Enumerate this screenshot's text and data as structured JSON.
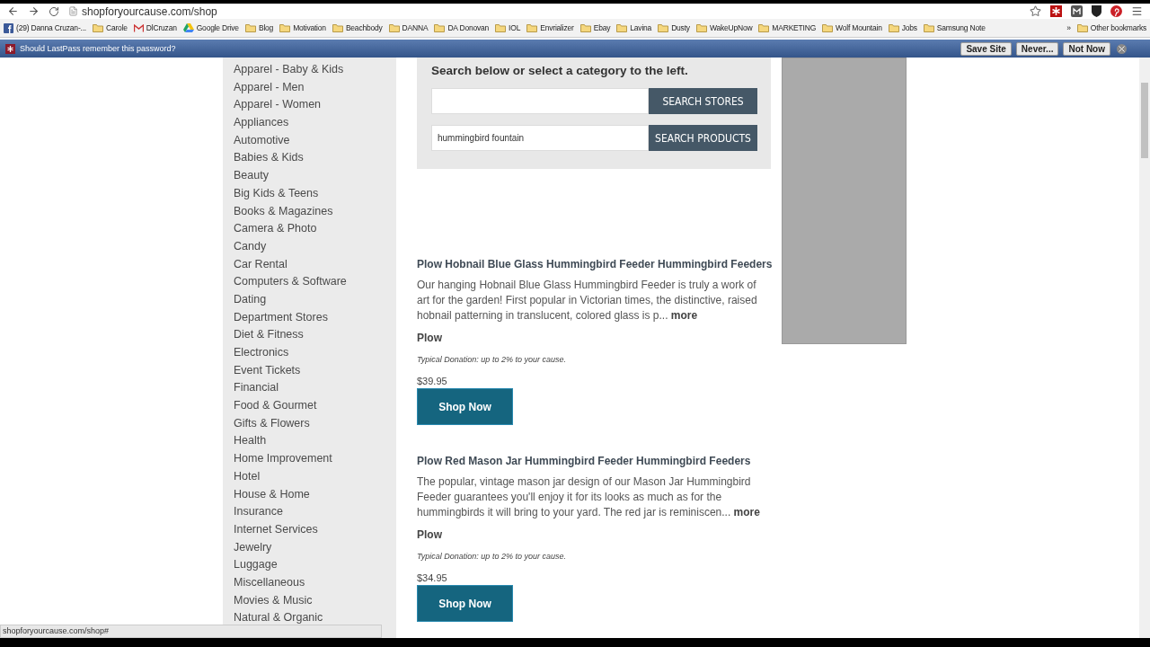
{
  "browser": {
    "url": "shopforyourcause.com/shop",
    "bookmarks": [
      {
        "kind": "facebook",
        "label": "(29) Danna Cruzan-..."
      },
      {
        "kind": "folder",
        "label": "Carole"
      },
      {
        "kind": "mail",
        "label": "DlCruzan"
      },
      {
        "kind": "drive",
        "label": "Google Drive"
      },
      {
        "kind": "folder",
        "label": "Blog"
      },
      {
        "kind": "folder",
        "label": "Motivation"
      },
      {
        "kind": "folder",
        "label": "Beachbody"
      },
      {
        "kind": "folder",
        "label": "DANNA"
      },
      {
        "kind": "folder",
        "label": "DA Donovan"
      },
      {
        "kind": "folder",
        "label": "IOL"
      },
      {
        "kind": "folder",
        "label": "Envrializer"
      },
      {
        "kind": "folder",
        "label": "Ebay"
      },
      {
        "kind": "folder",
        "label": "Lavina"
      },
      {
        "kind": "folder",
        "label": "Dusty"
      },
      {
        "kind": "folder",
        "label": "WakeUpNow"
      },
      {
        "kind": "folder",
        "label": "MARKETING"
      },
      {
        "kind": "folder",
        "label": "Wolf Mountain"
      },
      {
        "kind": "folder",
        "label": "Jobs"
      },
      {
        "kind": "folder",
        "label": "Samsung Note"
      }
    ],
    "more_bookmarks": "»",
    "other_bookmarks": "Other bookmarks",
    "lastpass": {
      "message": "Should LastPass remember this password?",
      "buttons": [
        "Save Site",
        "Never...",
        "Not Now"
      ]
    }
  },
  "sidebar": {
    "categories": [
      "Apparel - Baby & Kids",
      "Apparel - Men",
      "Apparel - Women",
      "Appliances",
      "Automotive",
      "Babies & Kids",
      "Beauty",
      "Big Kids & Teens",
      "Books & Magazines",
      "Camera & Photo",
      "Candy",
      "Car Rental",
      "Computers & Software",
      "Dating",
      "Department Stores",
      "Diet & Fitness",
      "Electronics",
      "Event Tickets",
      "Financial",
      "Food & Gourmet",
      "Gifts & Flowers",
      "Health",
      "Home Improvement",
      "Hotel",
      "House & Home",
      "Insurance",
      "Internet Services",
      "Jewelry",
      "Luggage",
      "Miscellaneous",
      "Movies & Music",
      "Natural & Organic"
    ]
  },
  "search": {
    "heading": "Search below or select a category to the left.",
    "rows": [
      {
        "value": "",
        "button": "SEARCH STORES"
      },
      {
        "value": "hummingbird fountain",
        "button": "SEARCH PRODUCTS"
      }
    ]
  },
  "products": [
    {
      "title": "Plow Hobnail Blue Glass Hummingbird Feeder Hummingbird Feeders",
      "description": "Our hanging Hobnail Blue Glass Hummingbird Feeder is truly a work of art for the garden! First popular in Victorian times, the distinctive, raised hobnail patterning in translucent, colored glass is p...",
      "more": "more",
      "brand": "Plow",
      "donation": "Typical Donation: up to 2% to your cause.",
      "price": "$39.95",
      "button": "Shop Now"
    },
    {
      "title": "Plow Red Mason Jar Hummingbird Feeder Hummingbird Feeders",
      "description": "The popular, vintage mason jar design of our Mason Jar Hummingbird Feeder guarantees you'll enjoy it for its looks as much as for the hummingbirds it will bring to your yard. The red jar is reminiscen...",
      "more": "more",
      "brand": "Plow",
      "donation": "Typical Donation: up to 2% to your cause.",
      "price": "$34.95",
      "button": "Shop Now"
    }
  ],
  "status_bar": "shopforyourcause.com/shop#"
}
